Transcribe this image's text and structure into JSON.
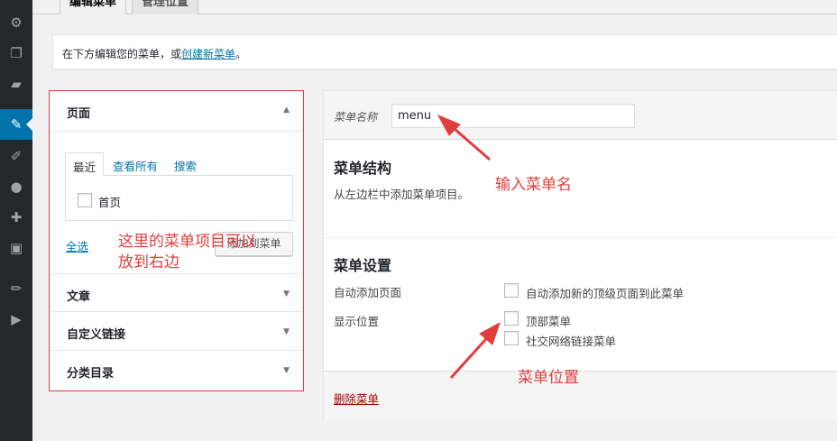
{
  "tabs": [
    {
      "label": "编辑菜单",
      "active": true
    },
    {
      "label": "管理位置",
      "active": false
    }
  ],
  "notice": {
    "prefix": "在下方编辑您的菜单，或",
    "link": "创建新菜单",
    "suffix": "。"
  },
  "left": {
    "pages": {
      "title": "页面",
      "tabs": [
        "最近",
        "查看所有",
        "搜索"
      ],
      "items": [
        {
          "label": "首页",
          "checked": false
        }
      ],
      "select_all": "全选",
      "add_button": "添加到菜单"
    },
    "sections": [
      "文章",
      "自定义链接",
      "分类目录"
    ]
  },
  "menu": {
    "name_label": "菜单名称",
    "name_value": "menu",
    "structure_title": "菜单结构",
    "structure_desc": "从左边栏中添加菜单项目。",
    "settings_title": "菜单设置",
    "auto_add_label": "自动添加页面",
    "auto_add_option": "自动添加新的顶级页面到此菜单",
    "location_label": "显示位置",
    "locations": [
      "顶部菜单",
      "社交网络链接菜单"
    ],
    "delete_link": "删除菜单"
  },
  "annotations": {
    "left_note_line1": "这里的菜单项目可以",
    "left_note_line2": "放到右边",
    "input_name": "输入菜单名",
    "menu_position": "菜单位置",
    "color": "#e23d3d"
  },
  "sidebar_icons": [
    "plugins-icon",
    "pages-icon",
    "comments-icon",
    "appearance-icon",
    "plugins-brush-icon",
    "users-icon",
    "tools-icon",
    "settings-icon",
    "edit-icon",
    "media-play-icon"
  ]
}
